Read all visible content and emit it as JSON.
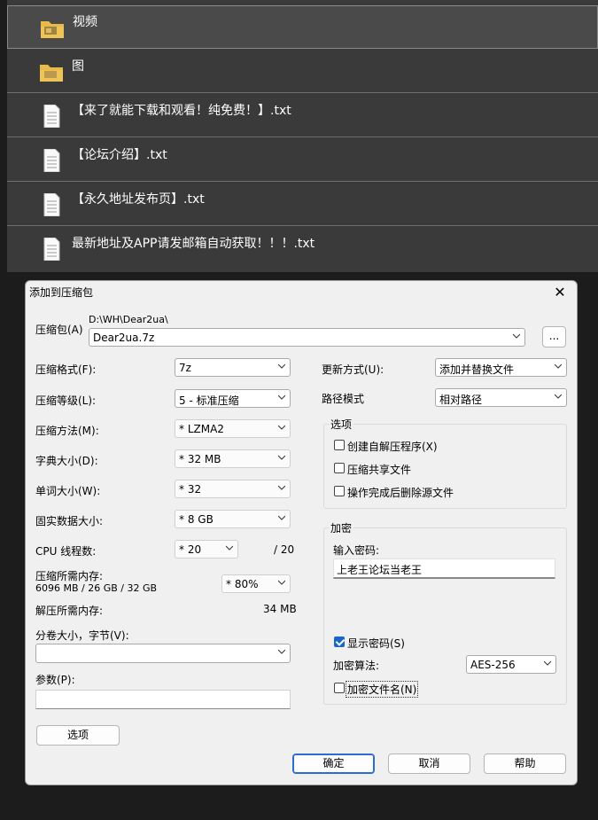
{
  "files": [
    {
      "name": "视频",
      "icon": "folder-icon",
      "selected": true
    },
    {
      "name": "图",
      "icon": "folder-icon",
      "selected": false
    },
    {
      "name": "【来了就能下载和观看！纯免费！】.txt",
      "icon": "text-file-icon",
      "selected": false
    },
    {
      "name": "【论坛介绍】.txt",
      "icon": "text-file-icon",
      "selected": false
    },
    {
      "name": "【永久地址发布页】.txt",
      "icon": "text-file-icon",
      "selected": false
    },
    {
      "name": "最新地址及APP请发邮箱自动获取！！！.txt",
      "icon": "text-file-icon",
      "selected": false
    }
  ],
  "dialog": {
    "title": "添加到压缩包",
    "close": "✕",
    "archive_label": "压缩包(A)",
    "archive_path": "D:\\WH\\Dear2ua\\",
    "archive_name": "Dear2ua.7z",
    "browse": "...",
    "format_label": "压缩格式(F):",
    "format_value": "7z",
    "level_label": "压缩等级(L):",
    "level_value": "5 - 标准压缩",
    "method_label": "压缩方法(M):",
    "method_value": "* LZMA2",
    "dict_label": "字典大小(D):",
    "dict_value": "* 32 MB",
    "word_label": "单词大小(W):",
    "word_value": "* 32",
    "solid_label": "固实数据大小:",
    "solid_value": "* 8 GB",
    "cpu_label": "CPU 线程数:",
    "cpu_value": "* 20",
    "cpu_total": "/ 20",
    "mem_label": "压缩所需内存:",
    "mem_info": "6096 MB / 26 GB / 32 GB",
    "mem_value": "* 80%",
    "decomp_label": "解压所需内存:",
    "decomp_value": "34 MB",
    "split_label": "分卷大小，字节(V):",
    "split_value": "",
    "params_label": "参数(P):",
    "params_value": "",
    "options_button": "选项",
    "update_label": "更新方式(U):",
    "update_value": "添加并替换文件",
    "path_label": "路径模式",
    "path_value": "相对路径",
    "options_group": "选项",
    "opt_sfx": "创建自解压程序(X)",
    "opt_shared": "压缩共享文件",
    "opt_delete": "操作完成后删除源文件",
    "encrypt_group": "加密",
    "password_label": "输入密码:",
    "password_value": "上老王论坛当老王",
    "show_password": "显示密码(S)",
    "enc_method_label": "加密算法:",
    "enc_method_value": "AES-256",
    "encrypt_names": "加密文件名(N)",
    "ok": "确定",
    "cancel": "取消",
    "help": "帮助"
  }
}
